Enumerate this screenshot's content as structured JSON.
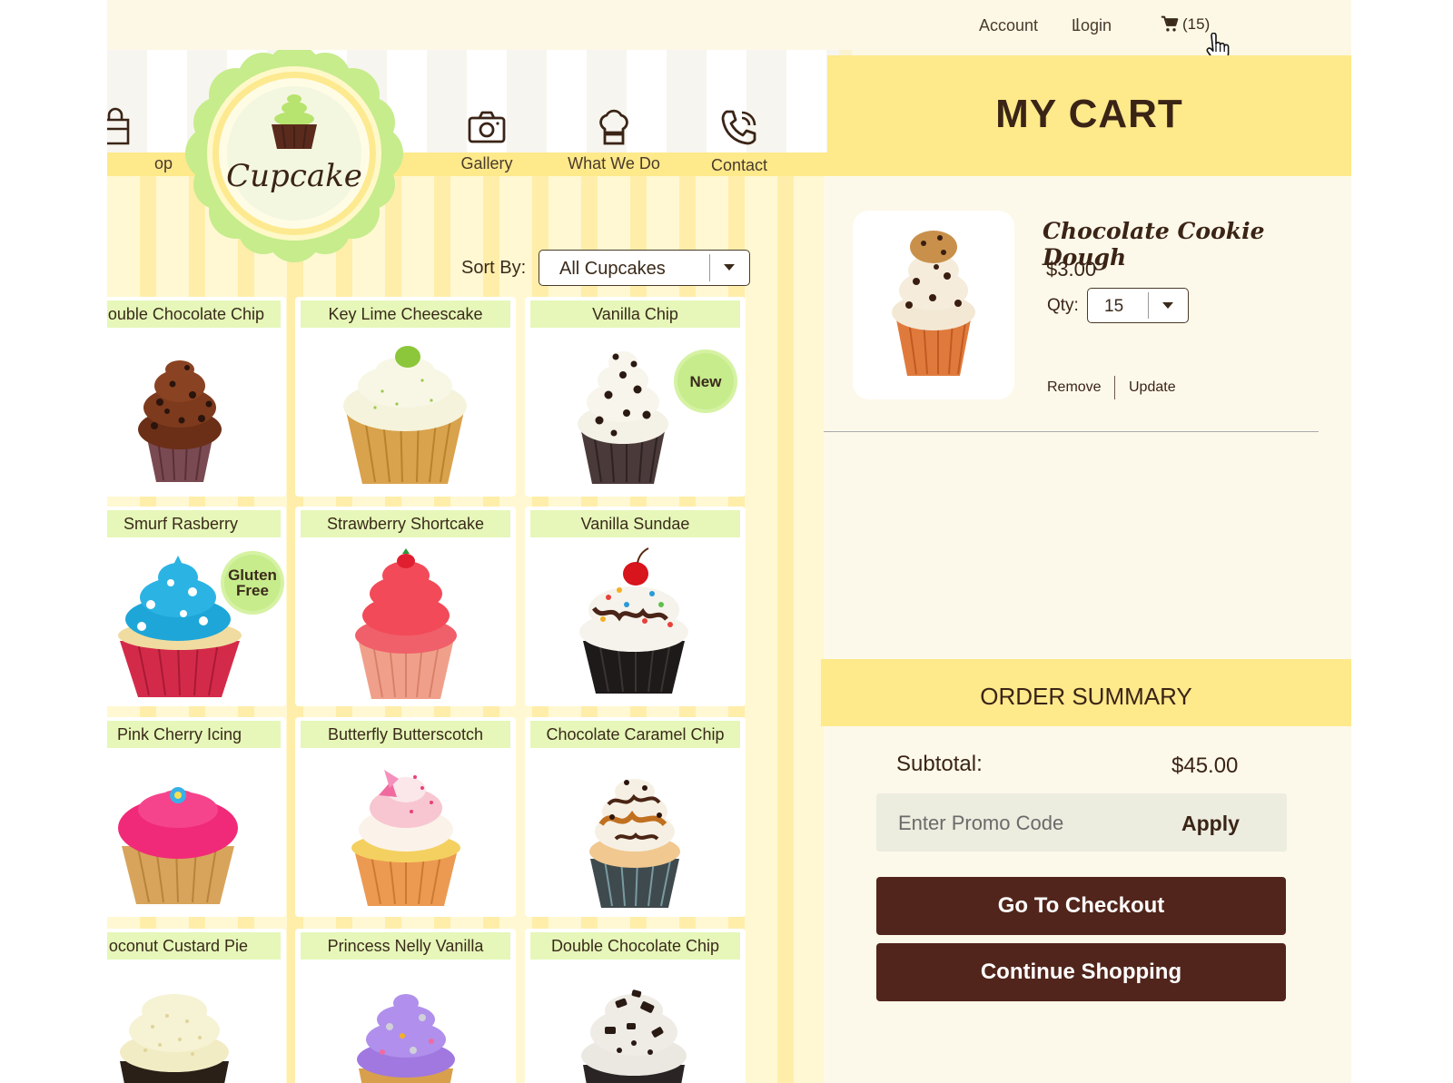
{
  "topbar": {
    "account": "Account",
    "separator": "I",
    "login": "Login",
    "cart_count": "(15)",
    "cart_icon": "shopping-cart-icon",
    "cursor_icon": "hand-pointer-icon"
  },
  "nav": {
    "shop": "op",
    "gallery": "Gallery",
    "what_we_do": "What We Do",
    "contact": "Contact",
    "icons": [
      "shop-bag-icon",
      "camera-icon",
      "chef-hat-icon",
      "phone-icon"
    ]
  },
  "logo": {
    "text": "Cupcake",
    "icon": "cupcake-icon"
  },
  "sort": {
    "label": "Sort By:",
    "value": "All Cupcakes"
  },
  "products": [
    {
      "name": "ouble Chocolate Chip",
      "badge": ""
    },
    {
      "name": "Key Lime Cheescake",
      "badge": ""
    },
    {
      "name": "Vanilla Chip",
      "badge": "New"
    },
    {
      "name": "Smurf Rasberry",
      "badge": "Gluten Free"
    },
    {
      "name": "Strawberry Shortcake",
      "badge": ""
    },
    {
      "name": "Vanilla Sundae",
      "badge": ""
    },
    {
      "name": "Pink Cherry Icing",
      "badge": ""
    },
    {
      "name": "Butterfly Butterscotch",
      "badge": ""
    },
    {
      "name": "Chocolate Caramel Chip",
      "badge": ""
    },
    {
      "name": "oconut Custard Pie",
      "badge": ""
    },
    {
      "name": "Princess Nelly Vanilla",
      "badge": ""
    },
    {
      "name": "Double Chocolate Chip",
      "badge": ""
    }
  ],
  "cart": {
    "title": "MY CART",
    "item": {
      "name": "Chocolate Cookie Dough",
      "price": "$3.00",
      "qty_label": "Qty:",
      "qty": "15",
      "remove": "Remove",
      "update": "Update"
    }
  },
  "summary": {
    "title": "ORDER SUMMARY",
    "subtotal_label": "Subtotal:",
    "subtotal_value": "$45.00",
    "promo_placeholder": "Enter Promo Code",
    "apply": "Apply",
    "checkout": "Go To Checkout",
    "continue": "Continue Shopping"
  },
  "colors": {
    "page_bg": "#fdf8e4",
    "accent_yellow": "#fee98b",
    "card_title_green": "#e6f7b9",
    "logo_green": "#c6ec8c",
    "brand_brown": "#51251c",
    "text_brown": "#3a2416"
  }
}
